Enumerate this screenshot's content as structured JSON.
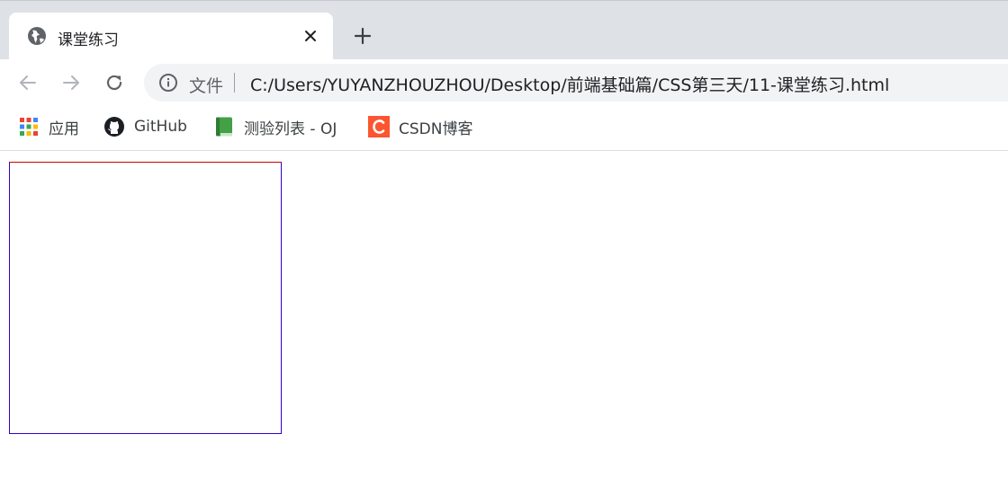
{
  "browser": {
    "tab": {
      "title": "课堂练习",
      "favicon": "globe-icon",
      "close_icon": "close-icon"
    },
    "new_tab_icon": "plus-icon",
    "toolbar": {
      "back_icon": "arrow-left-icon",
      "forward_icon": "arrow-right-icon",
      "reload_icon": "reload-icon",
      "omnibox": {
        "info_icon": "info-icon",
        "chip_label": "文件",
        "url": "C:/Users/YUYANZHOUZHOU/Desktop/前端基础篇/CSS第三天/11-课堂练习.html"
      }
    },
    "bookmarks": [
      {
        "label": "应用",
        "icon": "apps-grid-icon"
      },
      {
        "label": "GitHub",
        "icon": "github-icon"
      },
      {
        "label": "测验列表 - OJ",
        "icon": "book-icon"
      },
      {
        "label": "CSDN博客",
        "icon": "csdn-icon"
      }
    ]
  },
  "page": {
    "box_colors": {
      "top": "#cc0000",
      "sides": "#3300cc"
    }
  },
  "colors": {
    "tabstrip": "#dee1e6",
    "omnibox": "#f1f3f4",
    "csdn_brand": "#fc5531",
    "book_green": "#43a047"
  }
}
